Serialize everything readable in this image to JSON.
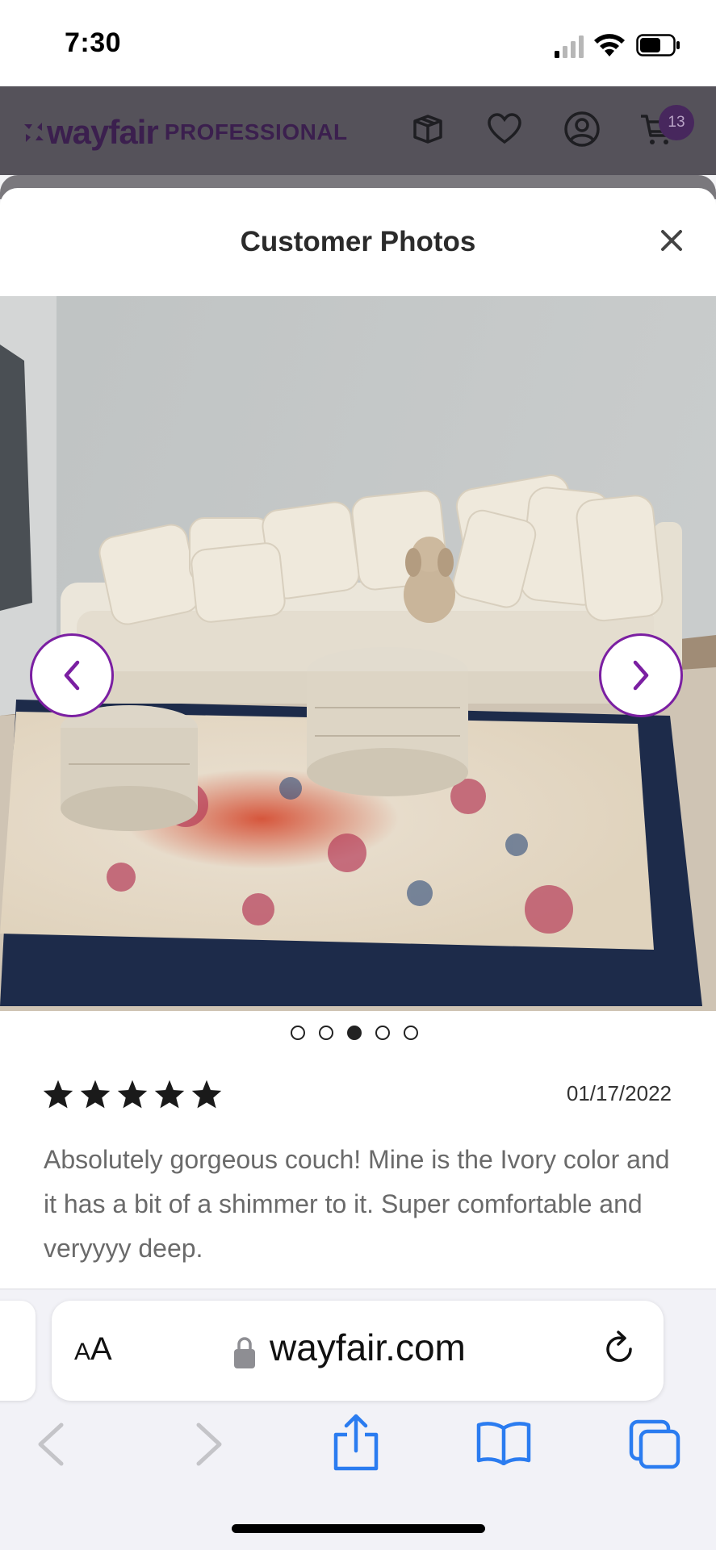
{
  "status_bar": {
    "time": "7:30"
  },
  "header": {
    "logo_word": "wayfair",
    "logo_pro": "PROFESSIONAL",
    "cart_count": "13",
    "icons": [
      "gift-box-icon",
      "heart-icon",
      "account-icon",
      "cart-icon"
    ]
  },
  "modal": {
    "title": "Customer Photos",
    "close_icon": "close-icon",
    "photo": {
      "description_icon": "customer-photo",
      "current_index": 3,
      "total": 5
    },
    "review": {
      "rating": 5,
      "max_rating": 5,
      "date": "01/17/2022",
      "text": "Absolutely gorgeous couch! Mine is the Ivory color and it has a bit of a shimmer to it. Super comfortable and veryyyy deep."
    }
  },
  "browser": {
    "aa_label_small": "A",
    "aa_label_large": "A",
    "url": "wayfair.com",
    "toolbar": [
      "back-icon",
      "forward-icon",
      "share-icon",
      "bookmarks-icon",
      "tabs-icon"
    ]
  },
  "colors": {
    "brand_purple": "#7b1fa2",
    "header_overlay": "#55525a"
  }
}
